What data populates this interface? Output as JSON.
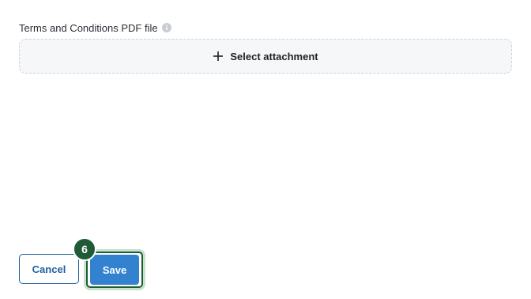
{
  "field": {
    "label": "Terms and Conditions PDF file",
    "info_icon": "info-icon"
  },
  "attachment": {
    "icon": "plus-icon",
    "label": "Select attachment"
  },
  "actions": {
    "cancel_label": "Cancel",
    "save_label": "Save"
  },
  "step_badge": {
    "number": "6"
  },
  "colors": {
    "primary": "#3382d0",
    "primary_dark": "#1f5f9e",
    "highlight": "#1f5b34",
    "highlight_glow": "#c7e2cc",
    "drop_zone_bg": "#f6f7f8"
  }
}
